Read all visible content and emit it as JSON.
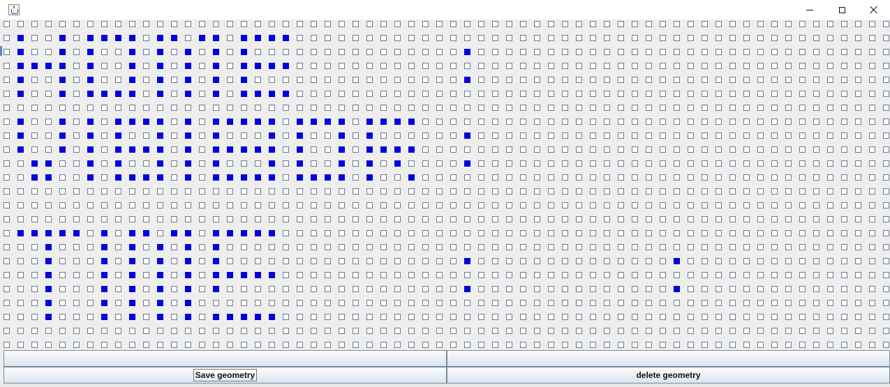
{
  "window": {
    "title": "",
    "icon": "java-coffee-icon",
    "controls": {
      "minimize": "minimize-icon",
      "maximize": "maximize-icon",
      "close": "close-icon"
    }
  },
  "grid": {
    "cols": 64,
    "rows": 24,
    "checked_color": "#0000e6",
    "checked": {
      "1": [
        1,
        4,
        6,
        7,
        8,
        9,
        11,
        12,
        14,
        15,
        17,
        18,
        19,
        20
      ],
      "2": [
        1,
        4,
        6,
        9,
        11,
        13,
        15,
        17,
        33
      ],
      "3": [
        1,
        2,
        3,
        4,
        6,
        9,
        11,
        13,
        15,
        17,
        18,
        19,
        20
      ],
      "4": [
        1,
        4,
        6,
        9,
        11,
        13,
        15,
        17,
        33
      ],
      "5": [
        1,
        4,
        6,
        7,
        8,
        9,
        11,
        13,
        15,
        17,
        18,
        19,
        20
      ],
      "7": [
        1,
        4,
        6,
        8,
        9,
        10,
        11,
        13,
        15,
        16,
        17,
        18,
        19,
        21,
        22,
        23,
        24,
        26,
        27,
        28,
        29
      ],
      "8": [
        1,
        4,
        6,
        8,
        11,
        13,
        15,
        19,
        21,
        24,
        26,
        33
      ],
      "9": [
        1,
        4,
        6,
        8,
        9,
        10,
        11,
        13,
        15,
        16,
        17,
        18,
        19,
        21,
        24,
        26,
        27,
        28,
        29
      ],
      "10": [
        2,
        3,
        6,
        8,
        11,
        13,
        15,
        19,
        21,
        24,
        26,
        28,
        33
      ],
      "11": [
        2,
        3,
        6,
        8,
        9,
        10,
        11,
        13,
        15,
        16,
        17,
        18,
        19,
        21,
        22,
        23,
        24,
        26,
        29
      ],
      "15": [
        1,
        2,
        3,
        4,
        5,
        7,
        9,
        10,
        12,
        13,
        15,
        16,
        17,
        18,
        19
      ],
      "16": [
        3,
        7,
        9,
        11,
        13,
        15
      ],
      "17": [
        3,
        7,
        9,
        11,
        13,
        15,
        33,
        48
      ],
      "18": [
        3,
        7,
        9,
        11,
        13,
        15,
        16,
        17,
        18,
        19
      ],
      "19": [
        3,
        7,
        9,
        11,
        13,
        15,
        33,
        48
      ],
      "20": [
        3,
        7,
        9,
        11,
        13
      ],
      "21": [
        3,
        7,
        9,
        11,
        13,
        15,
        16,
        17,
        18,
        19
      ]
    }
  },
  "buttons": {
    "top_left": "",
    "top_right": "",
    "save": "Save geometry",
    "delete": "delete geometry"
  }
}
